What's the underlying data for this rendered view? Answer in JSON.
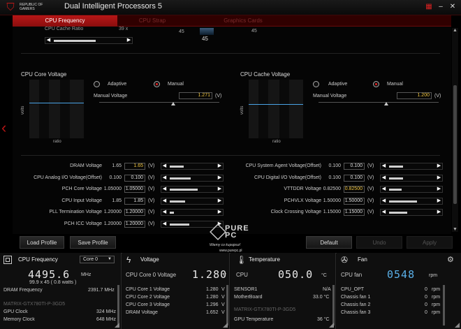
{
  "app": {
    "brand": "REPUBLIC OF GAMERS",
    "title": "Dual Intelligent Processors 5"
  },
  "tabs": [
    {
      "label": "CPU Frequency",
      "active": true
    },
    {
      "label": "CPU Strap",
      "active": false
    },
    {
      "label": "Graphics Cards",
      "active": false
    }
  ],
  "top_row": {
    "label": "CPU Cache Ratio",
    "value": "39 x",
    "left_num": "45",
    "mid_num": "45",
    "right_num": "45"
  },
  "core_voltage": {
    "title": "CPU Core Voltage",
    "y_axis": "volts",
    "x_axis": "ratio",
    "mode_adaptive": "Adaptive",
    "mode_manual": "Manual",
    "manual_label": "Manual Voltage",
    "manual_value": "1.271",
    "unit": "(V)"
  },
  "cache_voltage": {
    "title": "CPU Cache Voltage",
    "y_axis": "volts",
    "x_axis": "ratio",
    "mode_adaptive": "Adaptive",
    "mode_manual": "Manual",
    "manual_label": "Manual Voltage",
    "manual_value": "1.200",
    "unit": "(V)"
  },
  "left_rows": [
    {
      "label": "DRAM Voltage",
      "current": "1.65",
      "value": "1.65",
      "unit": "(V)",
      "highlight": true
    },
    {
      "label": "CPU Analog I/O Voltage(Offset)",
      "current": "0.100",
      "value": "0.100",
      "unit": "(V)",
      "highlight": false
    },
    {
      "label": "PCH Core Voltage",
      "current": "1.05000",
      "value": "1.05000",
      "unit": "(V)",
      "highlight": false
    },
    {
      "label": "CPU Input Voltage",
      "current": "1.85",
      "value": "1.85",
      "unit": "(V)",
      "highlight": false
    },
    {
      "label": "PLL Termination Voltage",
      "current": "1.20000",
      "value": "1.20000",
      "unit": "(V)",
      "highlight": false
    },
    {
      "label": "PCH ICC Voltage",
      "current": "1.20000",
      "value": "1.20000",
      "unit": "(V)",
      "highlight": false
    }
  ],
  "right_rows": [
    {
      "label": "CPU System Agent Voltage(Offset)",
      "current": "0.100",
      "value": "0.100",
      "unit": "(V)",
      "highlight": false
    },
    {
      "label": "CPU Digital I/O Voltage(Offset)",
      "current": "0.100",
      "value": "0.100",
      "unit": "(V)",
      "highlight": false
    },
    {
      "label": "VTTDDR Voltage",
      "current": "0.82500",
      "value": "0.82500",
      "unit": "(V)",
      "highlight": true
    },
    {
      "label": "PCHVLX Voltage",
      "current": "1.50000",
      "value": "1.50000",
      "unit": "(V)",
      "highlight": false
    },
    {
      "label": "Clock Crossing Voltage",
      "current": "1.15000",
      "value": "1.15000",
      "unit": "(V)",
      "highlight": false
    }
  ],
  "buttons": {
    "load_profile": "Load Profile",
    "save_profile": "Save Profile",
    "default": "Default",
    "undo": "Undo",
    "apply": "Apply"
  },
  "watermark": {
    "brand": "PURE PC",
    "script": "Wiemy co kupujesz!",
    "site": "www.purepc.pl"
  },
  "panel_cpu": {
    "title": "CPU Frequency",
    "core_select": "Core 0",
    "freq": "4495.6",
    "freq_unit": "MHz",
    "sub": "99.9 x 45 ( 0.8 watts )",
    "dram_label": "DRAM Frequency",
    "dram_value": "2391.7 MHz",
    "model": "MATRIX-GTX780TI-P-3GD5",
    "gpu_label": "GPU Clock",
    "gpu_value": "324 MHz",
    "mem_label": "Memory Clock",
    "mem_value": "648 MHz"
  },
  "panel_voltage": {
    "title": "Voltage",
    "main_label": "CPU Core 0 Voltage",
    "main_value": "1.280",
    "main_unit": "V",
    "rows": [
      [
        "CPU Core 1 Voltage",
        "1.280",
        "V"
      ],
      [
        "CPU Core 2 Voltage",
        "1.280",
        "V"
      ],
      [
        "CPU Core 3 Voltage",
        "1.296",
        "V"
      ],
      [
        "DRAM Voltage",
        "1.652",
        "V"
      ]
    ]
  },
  "panel_temp": {
    "title": "Temperature",
    "main_label": "CPU",
    "main_value": "050.0",
    "main_unit": "°C",
    "rows": [
      [
        "SENSOR1",
        "N/A"
      ],
      [
        "MotherBoard",
        "33.0 °C"
      ]
    ],
    "model": "MATRIX-GTX780TI-P-3GD5",
    "gpu_label": "GPU Temperature",
    "gpu_value": "36 °C"
  },
  "panel_fan": {
    "title": "Fan",
    "main_label": "CPU fan",
    "main_value": "0548",
    "main_unit": "rpm",
    "rows": [
      [
        "CPU_OPT",
        "0",
        "rpm"
      ],
      [
        "Chassis fan 1",
        "0",
        "rpm"
      ],
      [
        "Chassis fan 2",
        "0",
        "rpm"
      ],
      [
        "Chassis fan 3",
        "0",
        "rpm"
      ]
    ]
  },
  "colors": {
    "accent": "#b71616",
    "highlight_value": "#f3c842",
    "graph_line": "#4aa3e6",
    "fan_value": "#5ab0e8"
  }
}
